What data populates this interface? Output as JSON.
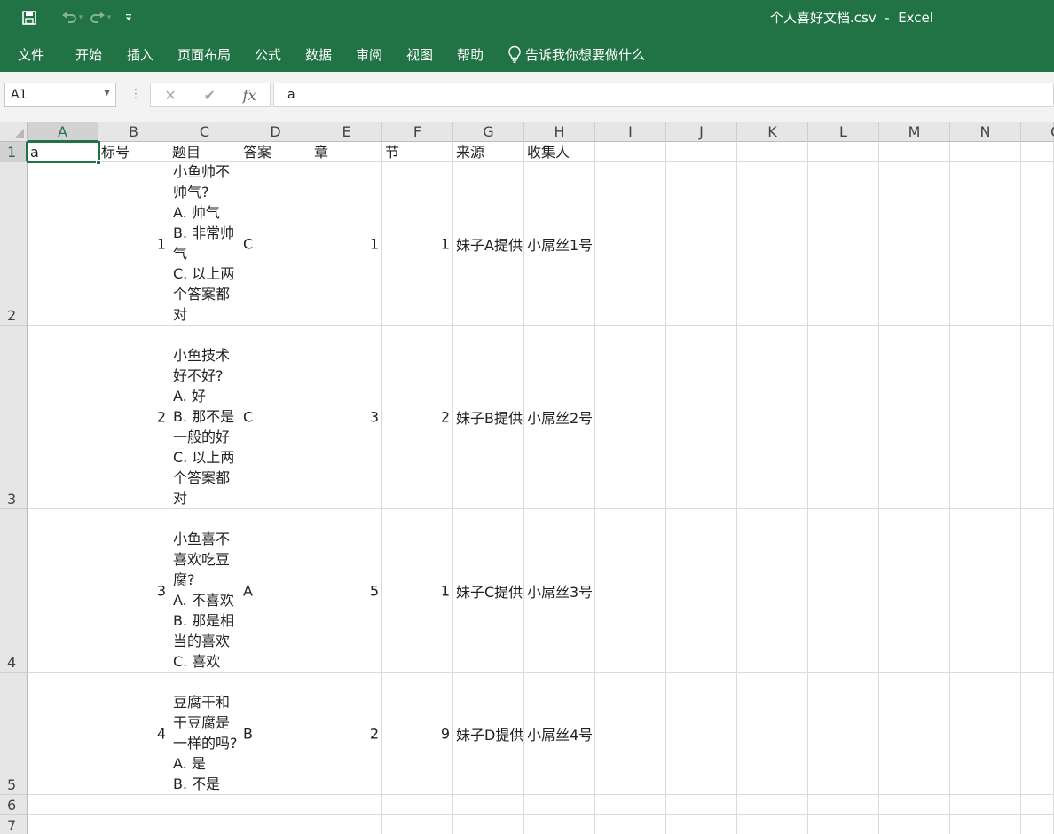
{
  "window": {
    "title": "个人喜好文档.csv  -  Excel"
  },
  "menu": [
    "文件",
    "开始",
    "插入",
    "页面布局",
    "公式",
    "数据",
    "审阅",
    "视图",
    "帮助"
  ],
  "tell_me": "告诉我你想要做什么",
  "formula_bar": {
    "name_box": "A1",
    "content": "a",
    "fx_label": "fx"
  },
  "columns": [
    "A",
    "B",
    "C",
    "D",
    "E",
    "F",
    "G",
    "H",
    "I",
    "J",
    "K",
    "L",
    "M",
    "N",
    "O"
  ],
  "rows": [
    "1",
    "2",
    "3",
    "4",
    "5",
    "6",
    "7"
  ],
  "selected_cell": "A1",
  "sheet": {
    "header": [
      "a",
      "标号",
      "题目",
      "答案",
      "章",
      "节",
      "来源",
      "收集人"
    ],
    "records": [
      {
        "num": "1",
        "question_lines": [
          "小鱼帅不帅气?",
          "A. 帅气",
          "B. 非常帅气",
          "C. 以上两个答案都对"
        ],
        "answer": "C",
        "chapter": "1",
        "section": "1",
        "source": "妹子A提供",
        "collector": "小屌丝1号"
      },
      {
        "num": "2",
        "question_lines": [
          "小鱼技术好不好?",
          "A. 好",
          "B. 那不是一般的好",
          "C. 以上两个答案都对"
        ],
        "answer": "C",
        "chapter": "3",
        "section": "2",
        "source": "妹子B提供",
        "collector": "小屌丝2号"
      },
      {
        "num": "3",
        "question_lines": [
          "小鱼喜不喜欢吃豆腐?",
          "A. 不喜欢",
          "B. 那是相当的喜欢",
          "C. 喜欢"
        ],
        "answer": "A",
        "chapter": "5",
        "section": "1",
        "source": "妹子C提供",
        "collector": "小屌丝3号"
      },
      {
        "num": "4",
        "question_lines": [
          "豆腐干和干豆腐是一样的吗?",
          "A. 是",
          "B. 不是"
        ],
        "answer": "B",
        "chapter": "2",
        "section": "9",
        "source": "妹子D提供",
        "collector": "小屌丝4号"
      }
    ]
  },
  "icons": {
    "save": "save-icon",
    "undo": "undo-icon",
    "redo": "redo-icon",
    "customize": "customize-qat-icon",
    "lightbulb": "lightbulb-icon",
    "cancel": "cancel-icon",
    "enter": "enter-icon"
  }
}
